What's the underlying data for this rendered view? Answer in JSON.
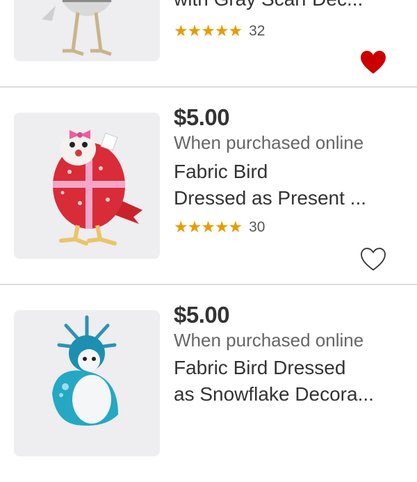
{
  "products": [
    {
      "title_lines": [
        "with Gray Scarf Dec..."
      ],
      "rating_stars": "★★★★★",
      "rating": 5,
      "review_count": "32",
      "favorited": true,
      "heart_color": "#cc0000"
    },
    {
      "price": "$5.00",
      "promo": "When purchased online",
      "title_lines": [
        "Fabric Bird",
        "Dressed as Present ..."
      ],
      "rating_stars": "★★★★★",
      "rating": 5,
      "review_count": "30",
      "favorited": false,
      "heart_color": "#333333"
    },
    {
      "price": "$5.00",
      "promo": "When purchased online",
      "title_lines": [
        "Fabric Bird Dressed",
        "as Snowflake Decora..."
      ]
    }
  ],
  "icons": {
    "favorite": "heart-icon",
    "star": "star-icon"
  },
  "colors": {
    "star": "#e69d00",
    "price": "#333333",
    "promo": "#666666",
    "divider": "#dddddd",
    "thumbnail_bg": "#eeedef"
  }
}
